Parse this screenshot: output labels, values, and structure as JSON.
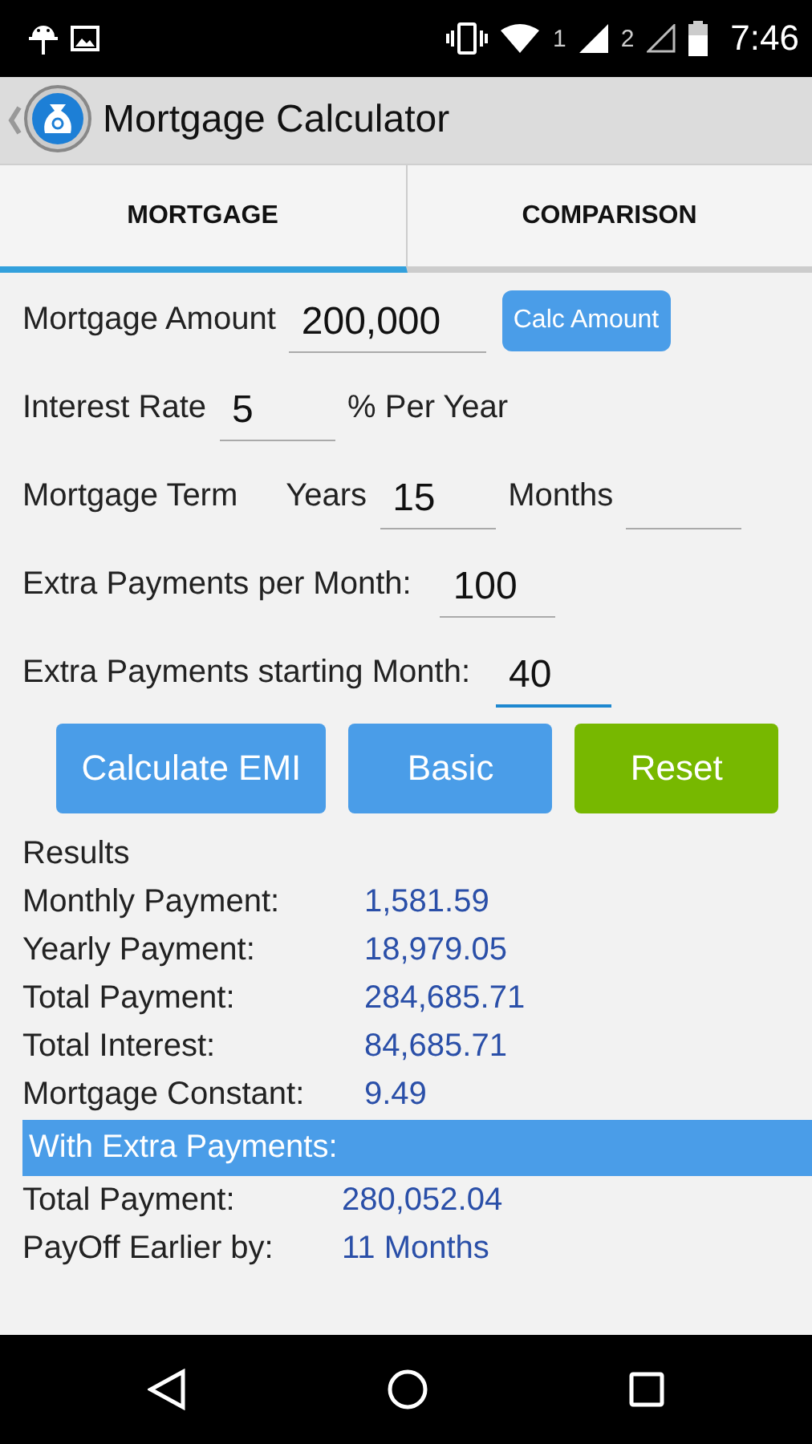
{
  "status_bar": {
    "sim_1": "1",
    "sim_2": "2",
    "time": "7:46"
  },
  "app_bar": {
    "title": "Mortgage Calculator"
  },
  "tabs": [
    {
      "label": "MORTGAGE",
      "selected": true
    },
    {
      "label": "COMPARISON",
      "selected": false
    }
  ],
  "form": [
    {
      "items": [
        {
          "kind": "label",
          "text": "Mortgage Amount"
        },
        {
          "kind": "field",
          "value": "200,000",
          "focused": false
        },
        {
          "kind": "button",
          "text": "Calc Amount"
        }
      ]
    },
    {
      "items": [
        {
          "kind": "label",
          "text": "Interest Rate"
        },
        {
          "kind": "field",
          "value": "5",
          "focused": false
        },
        {
          "kind": "label",
          "text": "% Per Year"
        }
      ]
    },
    {
      "items": [
        {
          "kind": "label",
          "text": "Mortgage Term"
        },
        {
          "kind": "label",
          "text": "Years"
        },
        {
          "kind": "field",
          "value": "15",
          "focused": false
        },
        {
          "kind": "label",
          "text": "Months"
        },
        {
          "kind": "field",
          "focused": false
        }
      ]
    },
    {
      "items": [
        {
          "kind": "label",
          "text": "Extra Payments per Month:"
        },
        {
          "kind": "field",
          "value": "100",
          "focused": false
        }
      ]
    },
    {
      "items": [
        {
          "kind": "label",
          "text": "Extra Payments starting Month:"
        },
        {
          "kind": "field",
          "value": "40",
          "focused": true
        }
      ]
    }
  ],
  "buttons": [
    {
      "label": "Calculate EMI",
      "color": "#4a9de8"
    },
    {
      "label": "Basic",
      "color": "#4a9de8"
    },
    {
      "label": "Reset",
      "color": "#77b800"
    }
  ],
  "results": {
    "heading": "Results",
    "rows": [
      {
        "label": "Monthly Payment:",
        "value": "1,581.59"
      },
      {
        "label": "Yearly Payment:",
        "value": "18,979.05"
      },
      {
        "label": "Total Payment:",
        "value": "284,685.71"
      },
      {
        "label": "Total Interest:",
        "value": "84,685.71"
      },
      {
        "label": "Mortgage Constant:",
        "value": "9.49"
      }
    ]
  },
  "extra_payments": {
    "heading": "With Extra Payments:",
    "rows": [
      {
        "label": "Total Payment:",
        "value": "280,052.04"
      },
      {
        "label": "PayOff Earlier by:",
        "value": "11 Months"
      }
    ]
  }
}
